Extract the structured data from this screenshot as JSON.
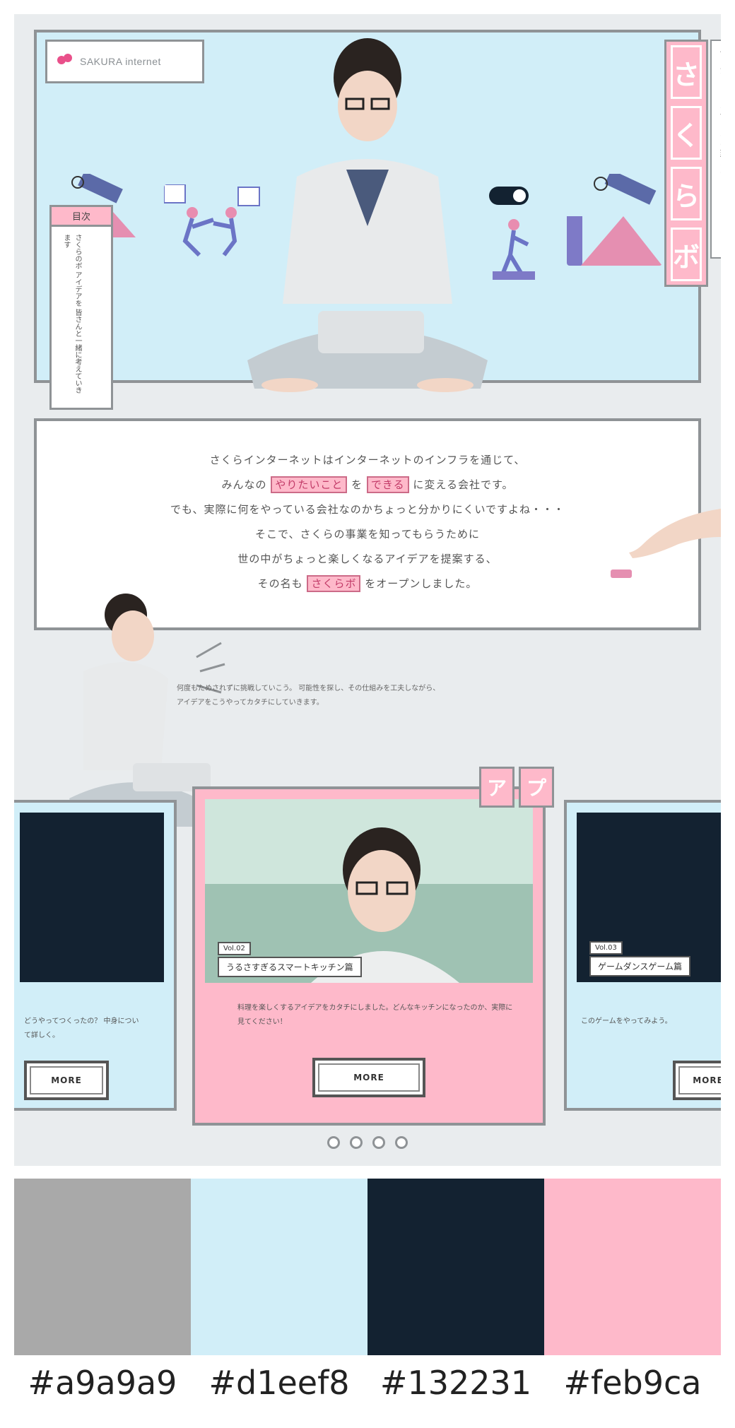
{
  "logo": {
    "text": "SAKURA internet"
  },
  "hero": {
    "title_chars": [
      "さ",
      "く",
      "ら",
      "ボ"
    ],
    "tagline": "やりたいことをできるに変える",
    "side_note": {
      "heading": "目次",
      "body": "さくらのボ アイデアを 皆さんと一緒に考えていきます"
    }
  },
  "intro": {
    "line1": "さくらインターネットはインターネットのインフラを通じて、",
    "line2_pre": "みんなの",
    "line2_hl1": "やりたいこと",
    "line2_mid": "を",
    "line2_hl2": "できる",
    "line2_post": "に変える会社です。",
    "line3": "でも、実際に何をやっている会社なのかちょっと分かりにくいですよね・・・",
    "line4": "そこで、さくらの事業を知ってもらうために",
    "line5": "世の中がちょっと楽しくなるアイデアを提案する、",
    "line6_pre": "その名も",
    "line6_hl": "さくらボ",
    "line6_post": "をオープンしました。"
  },
  "side_desc": "何度もためされずに挑戦していこう。 可能性を探し、その仕組みを工夫しながら、 アイデアをこうやってカタチにしていきます。",
  "app_tags": [
    "ア",
    "プ"
  ],
  "cards": {
    "left": {
      "desc": "どうやってつくったの？ 中身について詳しく。",
      "button": "MORE"
    },
    "center": {
      "number": "Vol.02",
      "title": "うるさすぎるスマートキッチン篇",
      "desc": "料理を楽しくするアイデアをカタチにしました。どんなキッチンになったのか、実際に見てください！",
      "button": "MORE"
    },
    "right": {
      "number": "Vol.03",
      "title": "ゲームダンスゲーム篇",
      "desc": "このゲームをやってみよう。",
      "button": "MORE"
    }
  },
  "pagination": {
    "count": 4
  },
  "palette": [
    {
      "hex": "#a9a9a9"
    },
    {
      "hex": "#d1eef8"
    },
    {
      "hex": "#132231"
    },
    {
      "hex": "#feb9ca"
    }
  ]
}
